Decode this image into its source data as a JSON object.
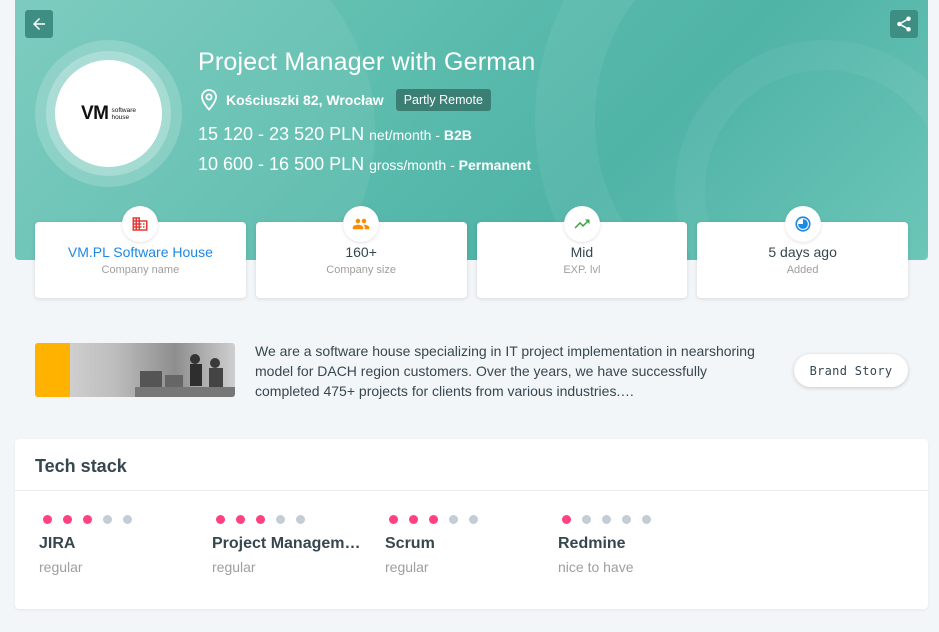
{
  "header": {
    "title": "Project Manager with German",
    "location": "Kościuszki 82, Wrocław",
    "remote_badge": "Partly Remote",
    "salaries": [
      {
        "range": "15 120 - 23 520 PLN",
        "period": "net/month",
        "type": "B2B"
      },
      {
        "range": "10 600 - 16 500 PLN",
        "period": "gross/month",
        "type": "Permanent"
      }
    ],
    "logo": {
      "text": "VM",
      "sub1": "software",
      "sub2": "house"
    }
  },
  "info_cards": [
    {
      "value": "VM.PL Software House",
      "label": "Company name",
      "icon": "building-icon"
    },
    {
      "value": "160+",
      "label": "Company size",
      "icon": "people-icon"
    },
    {
      "value": "Mid",
      "label": "EXP. lvl",
      "icon": "trending-up-icon"
    },
    {
      "value": "5 days ago",
      "label": "Added",
      "icon": "clock-icon"
    }
  ],
  "brand": {
    "description": "We are a software house specializing in IT project implementation in nearshoring model for DACH region customers. Over the years, we have successfully completed 475+ projects for clients from various industries.…",
    "button_label": "Brand Story"
  },
  "tech_stack": {
    "title": "Tech stack",
    "skills": [
      {
        "name": "JIRA",
        "level": "regular",
        "dots": 3
      },
      {
        "name": "Project Management",
        "level": "regular",
        "dots": 3
      },
      {
        "name": "Scrum",
        "level": "regular",
        "dots": 3
      },
      {
        "name": "Redmine",
        "level": "nice to have",
        "dots": 1
      }
    ]
  },
  "colors": {
    "hero": "#5ebeaf",
    "accent_pink": "#ff4081",
    "link_blue": "#1e88e5",
    "building_icon": "#e53935",
    "people_icon": "#fb8c00",
    "trend_icon": "#43a047",
    "clock_icon": "#1e88e5"
  }
}
